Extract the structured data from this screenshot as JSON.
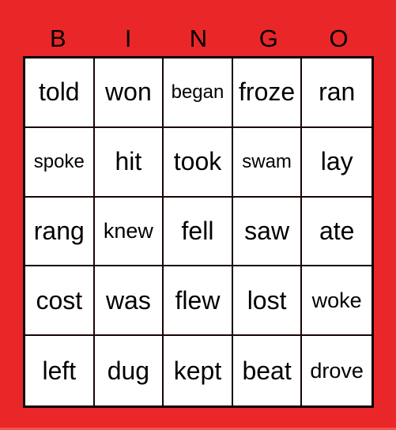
{
  "title_letters": [
    "B",
    "I",
    "N",
    "G",
    "O"
  ],
  "rows": [
    [
      "told",
      "won",
      "began",
      "froze",
      "ran"
    ],
    [
      "spoke",
      "hit",
      "took",
      "swam",
      "lay"
    ],
    [
      "rang",
      "knew",
      "fell",
      "saw",
      "ate"
    ],
    [
      "cost",
      "was",
      "flew",
      "lost",
      "woke"
    ],
    [
      "left",
      "dug",
      "kept",
      "beat",
      "drove"
    ]
  ],
  "colors": {
    "background": "#e92628",
    "card": "#ffffff",
    "grid_line": "#0a0000",
    "text": "#000000"
  }
}
